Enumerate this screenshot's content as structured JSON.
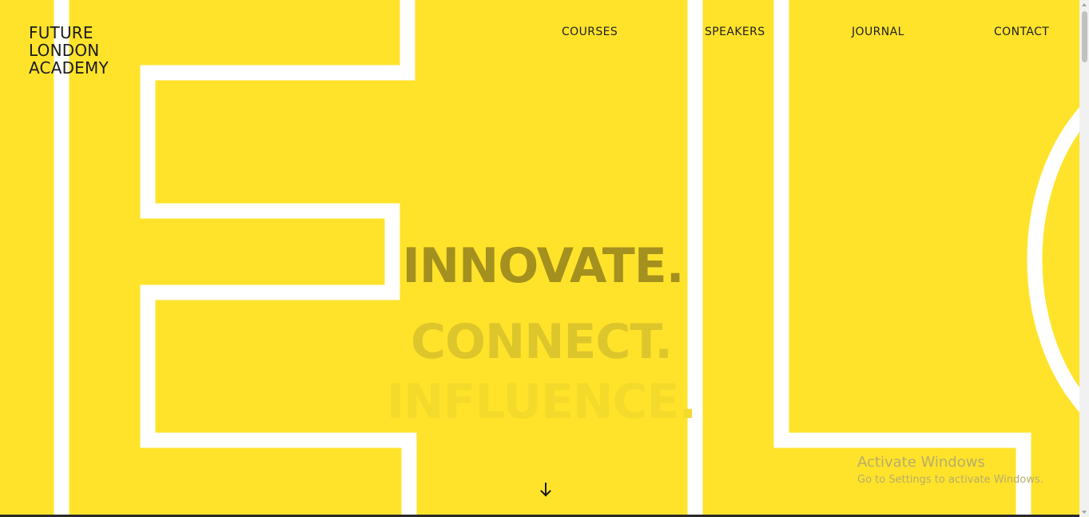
{
  "logo": {
    "line1": "FUTURE",
    "line2": "LONDON",
    "line3": "ACADEMY"
  },
  "nav": {
    "items": [
      {
        "label": "COURSES"
      },
      {
        "label": "SPEAKERS"
      },
      {
        "label": "JOURNAL"
      },
      {
        "label": "CONTACT"
      }
    ]
  },
  "hero": {
    "line1": "INNOVATE.",
    "line2": "CONNECT.",
    "line3": "INFLUENCE."
  },
  "scroll_icon": "arrow-down-icon",
  "watermark": {
    "title": "Activate Windows",
    "subtitle": "Go to Settings to activate Windows."
  },
  "colors": {
    "background": "#ffe32b",
    "outline": "#ffffff",
    "text": "#1b1b1b"
  }
}
